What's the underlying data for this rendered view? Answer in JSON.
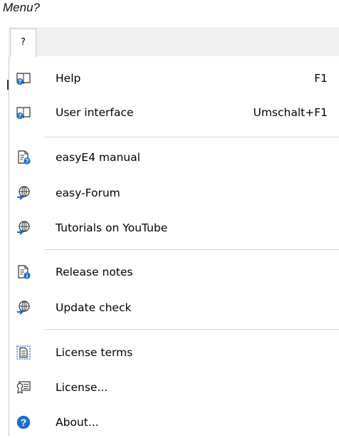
{
  "caption": "Menu?",
  "menubar": {
    "tab_label": "?"
  },
  "menu": {
    "items": [
      {
        "label": "Help",
        "shortcut": "F1",
        "icon": "help-book-icon"
      },
      {
        "label": "User interface",
        "shortcut": "Umschalt+F1",
        "icon": "help-book-icon"
      },
      {
        "label": "easyE4 manual",
        "icon": "document-help-icon"
      },
      {
        "label": "easy-Forum",
        "icon": "globe-link-icon"
      },
      {
        "label": "Tutorials on YouTube",
        "icon": "globe-link-icon"
      },
      {
        "label": "Release notes",
        "icon": "document-info-icon"
      },
      {
        "label": "Update check",
        "icon": "globe-link-icon"
      },
      {
        "label": "License terms",
        "icon": "license-document-icon"
      },
      {
        "label": "License...",
        "icon": "certificate-icon"
      },
      {
        "label": "About...",
        "icon": "question-circle-icon"
      }
    ]
  },
  "colors": {
    "accent_blue": "#1e6fc4",
    "separator": "#d6d6d6",
    "menubar": "#f0f0f0"
  }
}
